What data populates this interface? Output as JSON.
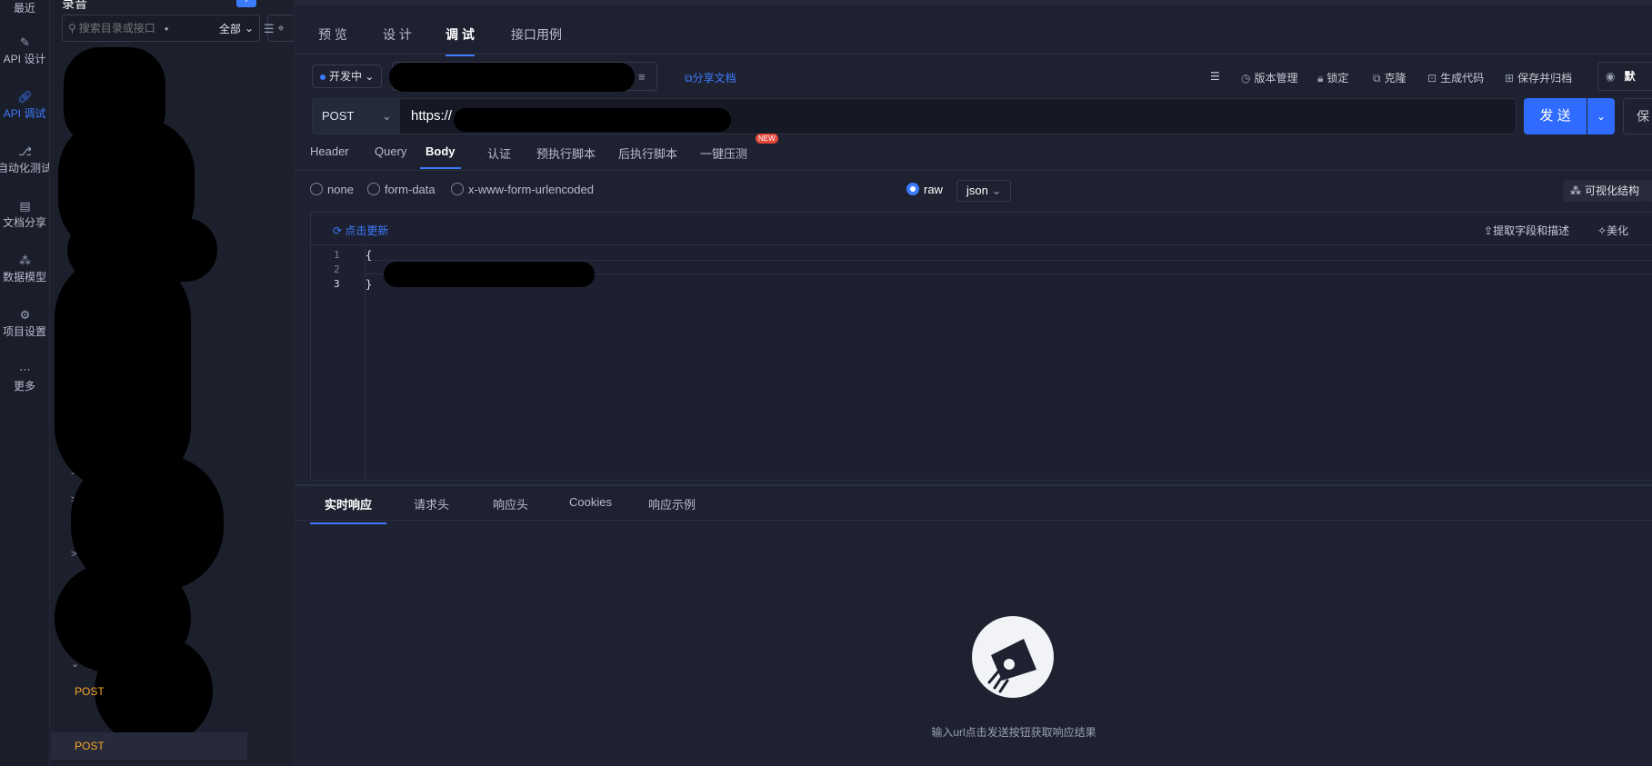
{
  "rail": {
    "items": [
      {
        "label": "最近",
        "icon": "clock-icon"
      },
      {
        "label": "API 设计",
        "icon": "edit-icon"
      },
      {
        "label": "API 调试",
        "icon": "link-icon"
      },
      {
        "label": "自动化测试",
        "icon": "flow-icon"
      },
      {
        "label": "文档分享",
        "icon": "doc-share-icon"
      },
      {
        "label": "数据模型",
        "icon": "model-icon"
      },
      {
        "label": "项目设置",
        "icon": "settings-icon"
      },
      {
        "label": "更多",
        "icon": "more-icon"
      }
    ]
  },
  "tree": {
    "title": "录音",
    "search_placeholder": "搜索目录或接口",
    "scope": "全部",
    "post_label": "POST"
  },
  "main": {
    "tabs": [
      "预 览",
      "设 计",
      "调 试",
      "接口用例"
    ],
    "active_tab": "调 试",
    "env": "开发中",
    "share": "分享文档",
    "tools": [
      "版本管理",
      "锁定",
      "克隆",
      "生成代码",
      "保存并归档"
    ],
    "preview_label": "默",
    "method": "POST",
    "url": "https://",
    "send": "发 送",
    "save": "保",
    "req_tabs": [
      "Header",
      "Query",
      "Body",
      "认证",
      "预执行脚本",
      "后执行脚本",
      "一键压测"
    ],
    "new_badge": "NEW",
    "body_types": [
      "none",
      "form-data",
      "x-www-form-urlencoded",
      "raw"
    ],
    "body_format": "json",
    "viz_label": "可视化结构",
    "viz_icon": "{}",
    "editor": {
      "update": "点击更新",
      "extract": "提取字段和描述",
      "beautify": "美化",
      "line_numbers": [
        "1",
        "2",
        "3"
      ],
      "line1": "{",
      "line3": "}"
    },
    "resp_tabs": [
      "实时响应",
      "请求头",
      "响应头",
      "Cookies",
      "响应示例"
    ],
    "empty_text": "输入url点击发送按钮获取响应结果"
  },
  "colors": {
    "accent": "#3d7bff",
    "post": "#f6a623",
    "badge": "#e5483b"
  }
}
